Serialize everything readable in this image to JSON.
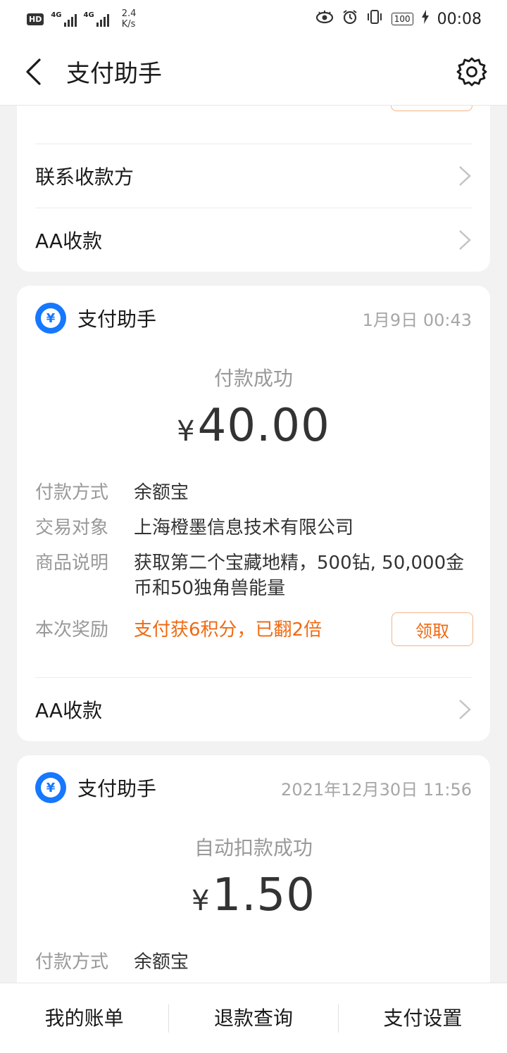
{
  "status_bar": {
    "hd": "HD",
    "net1": "4G",
    "net2": "4G",
    "speed_value": "2.4",
    "speed_unit": "K/s",
    "battery": "100",
    "time": "00:08"
  },
  "header": {
    "title": "支付助手"
  },
  "top_card": {
    "rows": [
      {
        "label": "联系收款方"
      },
      {
        "label": "AA收款"
      }
    ]
  },
  "messages": [
    {
      "sender": "支付助手",
      "time": "1月9日 00:43",
      "status": "付款成功",
      "currency": "¥",
      "amount": "40.00",
      "fields": [
        {
          "key": "付款方式",
          "value": "余额宝"
        },
        {
          "key": "交易对象",
          "value": "上海橙墨信息技术有限公司"
        },
        {
          "key": "商品说明",
          "value": "获取第二个宝藏地精，500钻, 50,000金币和50独角兽能量"
        },
        {
          "key": "本次奖励",
          "value": "支付获6积分，已翻2倍"
        }
      ],
      "claim_label": "领取",
      "row_label": "AA收款"
    },
    {
      "sender": "支付助手",
      "time": "2021年12月30日 11:56",
      "status": "自动扣款成功",
      "currency": "¥",
      "amount": "1.50",
      "fields": [
        {
          "key": "付款方式",
          "value": "余额宝"
        }
      ]
    }
  ],
  "bottom_tabs": [
    {
      "label": "我的账单"
    },
    {
      "label": "退款查询"
    },
    {
      "label": "支付设置"
    }
  ],
  "colors": {
    "accent_blue": "#1677ff",
    "accent_orange": "#ef6a12",
    "background": "#f2f2f2"
  }
}
